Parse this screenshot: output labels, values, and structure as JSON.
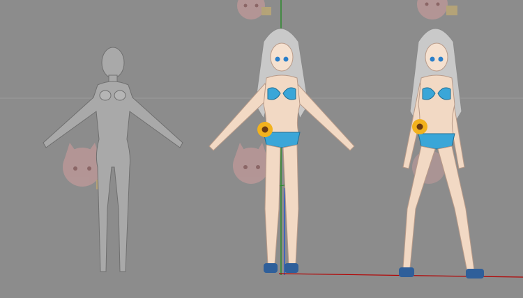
{
  "viewport": {
    "background": "#8c8c8c",
    "grid_line_color": "#9a9a9a",
    "axis_colors": {
      "x_axis": "#b40000",
      "y_axis": "#1e8a1e",
      "z_axis": "#1e50d2"
    }
  },
  "models": [
    {
      "name": "base-mesh",
      "kind": "grey untextured humanoid A-pose",
      "color": "#a9a9a9"
    },
    {
      "name": "character-textured-a",
      "kind": "anime girl, blue gingham bikini, sunflower",
      "accent": "#3aa6d8"
    },
    {
      "name": "character-textured-b",
      "kind": "anime girl, blue gingham bikini, sunflower, relaxed pose",
      "accent": "#3aa6d8"
    }
  ],
  "watermarks": [
    {
      "name": "chibi-watermark-1",
      "opacity": 0.45
    },
    {
      "name": "chibi-watermark-2",
      "opacity": 0.45
    },
    {
      "name": "chibi-watermark-3",
      "opacity": 0.45
    },
    {
      "name": "chibi-watermark-4",
      "opacity": 0.45
    },
    {
      "name": "chibi-watermark-5",
      "opacity": 0.45
    }
  ]
}
